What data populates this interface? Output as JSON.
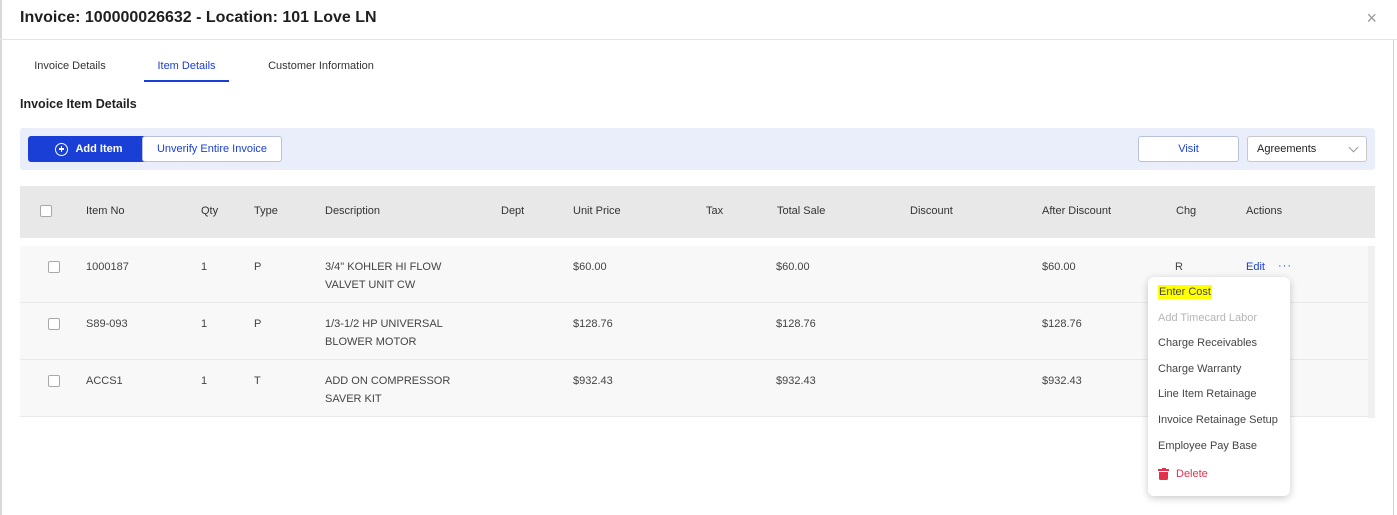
{
  "modal": {
    "title": "Invoice: 100000026632 - Location: 101 Love LN",
    "close_icon": "close-x-icon",
    "close_glyph": "×"
  },
  "tabs": [
    {
      "label": "Invoice Details",
      "active": false
    },
    {
      "label": "Item Details",
      "active": true
    },
    {
      "label": "Customer Information",
      "active": false
    }
  ],
  "section": {
    "title": "Invoice Item Details"
  },
  "toolbar": {
    "add_item_label": "Add Item",
    "add_item_icon": "plus-circle-icon",
    "unverify_label": "Unverify Entire Invoice",
    "visit_label": "Visit",
    "agreements_value": "Agreements"
  },
  "table": {
    "columns": [
      "Item No",
      "Qty",
      "Type",
      "Description",
      "Dept",
      "Unit Price",
      "Tax",
      "Total Sale",
      "Discount",
      "After Discount",
      "Chg",
      "Actions"
    ],
    "rows": [
      {
        "item_no": "1000187",
        "qty": "1",
        "type": "P",
        "desc1": "3/4\" KOHLER HI FLOW",
        "desc2": "VALVET UNIT CW",
        "dept": "",
        "unit_price": "$60.00",
        "tax": "",
        "total_sale": "$60.00",
        "discount": "",
        "after_discount": "$60.00",
        "chg": "R",
        "edit": "Edit",
        "more": "···"
      },
      {
        "item_no": "S89-093",
        "qty": "1",
        "type": "P",
        "desc1": "1/3-1/2 HP UNIVERSAL",
        "desc2": "BLOWER MOTOR",
        "dept": "",
        "unit_price": "$128.76",
        "tax": "",
        "total_sale": "$128.76",
        "discount": "",
        "after_discount": "$128.76",
        "chg": "",
        "edit": "",
        "more": ""
      },
      {
        "item_no": "ACCS1",
        "qty": "1",
        "type": "T",
        "desc1": "ADD ON COMPRESSOR",
        "desc2": "SAVER KIT",
        "dept": "",
        "unit_price": "$932.43",
        "tax": "",
        "total_sale": "$932.43",
        "discount": "",
        "after_discount": "$932.43",
        "chg": "",
        "edit": "",
        "more": ""
      }
    ]
  },
  "menu": {
    "items": [
      {
        "label": "Enter Cost",
        "state": "highlighted"
      },
      {
        "label": "Add Timecard Labor",
        "state": "disabled"
      },
      {
        "label": "Charge Receivables",
        "state": "normal"
      },
      {
        "label": "Charge Warranty",
        "state": "normal"
      },
      {
        "label": "Line Item Retainage",
        "state": "normal"
      },
      {
        "label": "Invoice Retainage Setup",
        "state": "normal"
      },
      {
        "label": "Employee Pay Base",
        "state": "normal"
      },
      {
        "label": "Delete",
        "state": "danger",
        "icon": "trash-icon"
      }
    ]
  },
  "colors": {
    "accent": "#1a3fd6",
    "toolbar_bg": "#eaeefb",
    "header_bg": "#e8e8e8",
    "danger": "#e3314b",
    "highlight": "#ffff00"
  }
}
